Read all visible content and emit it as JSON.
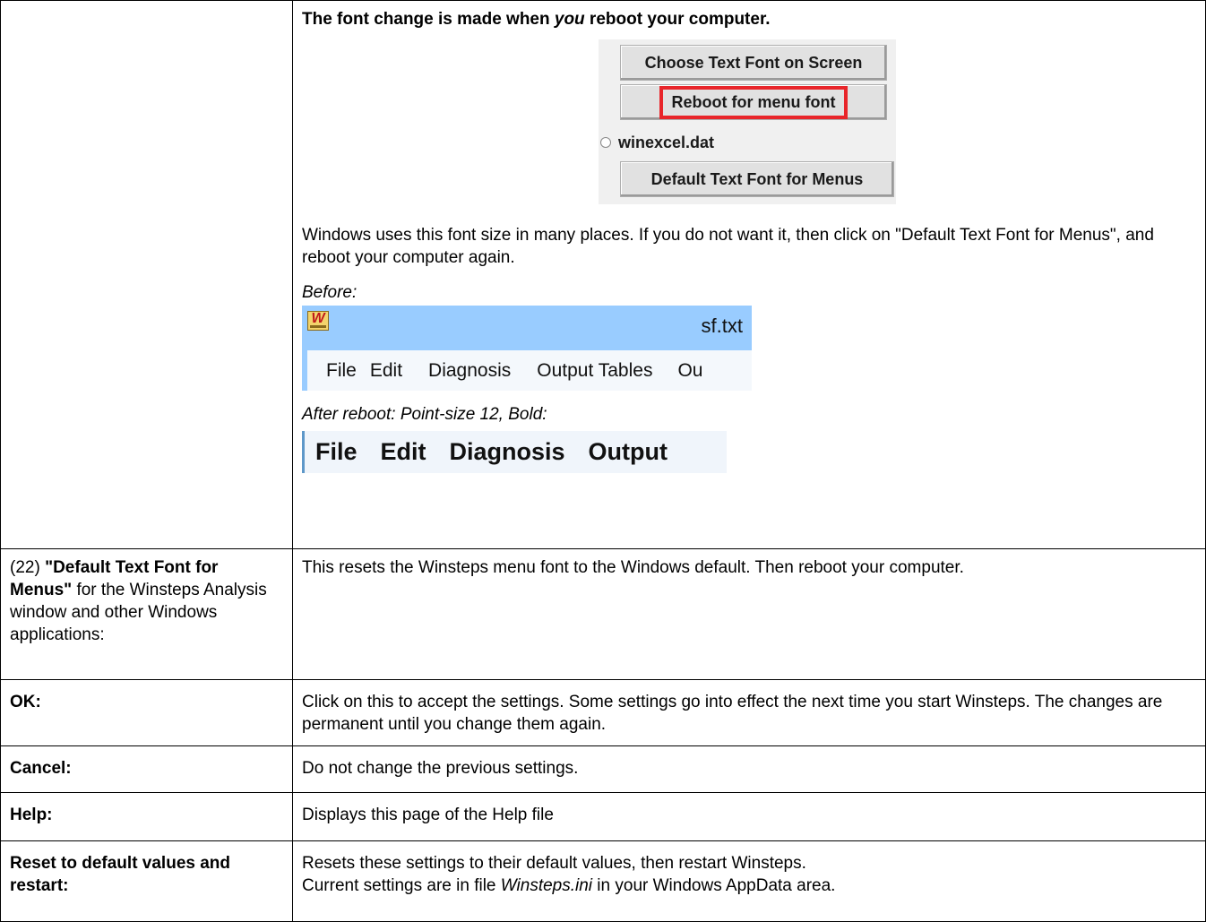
{
  "row_menu_font": {
    "label": "",
    "heading_pre": "The font change is made when ",
    "heading_em": "you",
    "heading_post": " reboot your computer.",
    "dialog": {
      "choose_button": "Choose Text Font on Screen",
      "reboot_button": "Reboot for menu font",
      "radio_label": "winexcel.dat",
      "default_button": "Default Text Font for Menus"
    },
    "para": "Windows uses this font size in many places. If you do not want it, then click on \"Default Text Font for Menus\", and reboot your computer again.",
    "before_caption": "Before:",
    "before_window": {
      "icon_letter": "W",
      "title": "sf.txt",
      "menu": [
        "File",
        "Edit",
        "Diagnosis",
        "Output Tables",
        "Ou"
      ]
    },
    "after_caption": "After reboot: Point-size 12, Bold:",
    "after_menu": [
      "File",
      "Edit",
      "Diagnosis",
      "Output"
    ]
  },
  "row_default_font": {
    "label_num": "(22) ",
    "label_bold": "\"Default Text Font for Menus\"",
    "label_rest": " for the Winsteps Analysis window and other Windows applications:",
    "value": "This resets the Winsteps menu font to the Windows default. Then reboot your computer."
  },
  "row_ok": {
    "label": "OK:",
    "value": "Click on this to accept the settings. Some settings go into effect the next time you start Winsteps. The changes are permanent until you change them again."
  },
  "row_cancel": {
    "label": "Cancel:",
    "value": "Do not change the previous settings."
  },
  "row_help": {
    "label": "Help:",
    "value": "Displays this page of the Help file"
  },
  "row_reset": {
    "label": "Reset to default values and restart:",
    "value_line1": "Resets these settings to their default values, then restart Winsteps.",
    "value_line2_pre": "Current settings are in file ",
    "value_line2_em": "Winsteps.ini",
    "value_line2_post": " in your Windows AppData area."
  },
  "colors": {
    "highlight_border": "#e8252a",
    "title_bar": "#99ccff"
  }
}
